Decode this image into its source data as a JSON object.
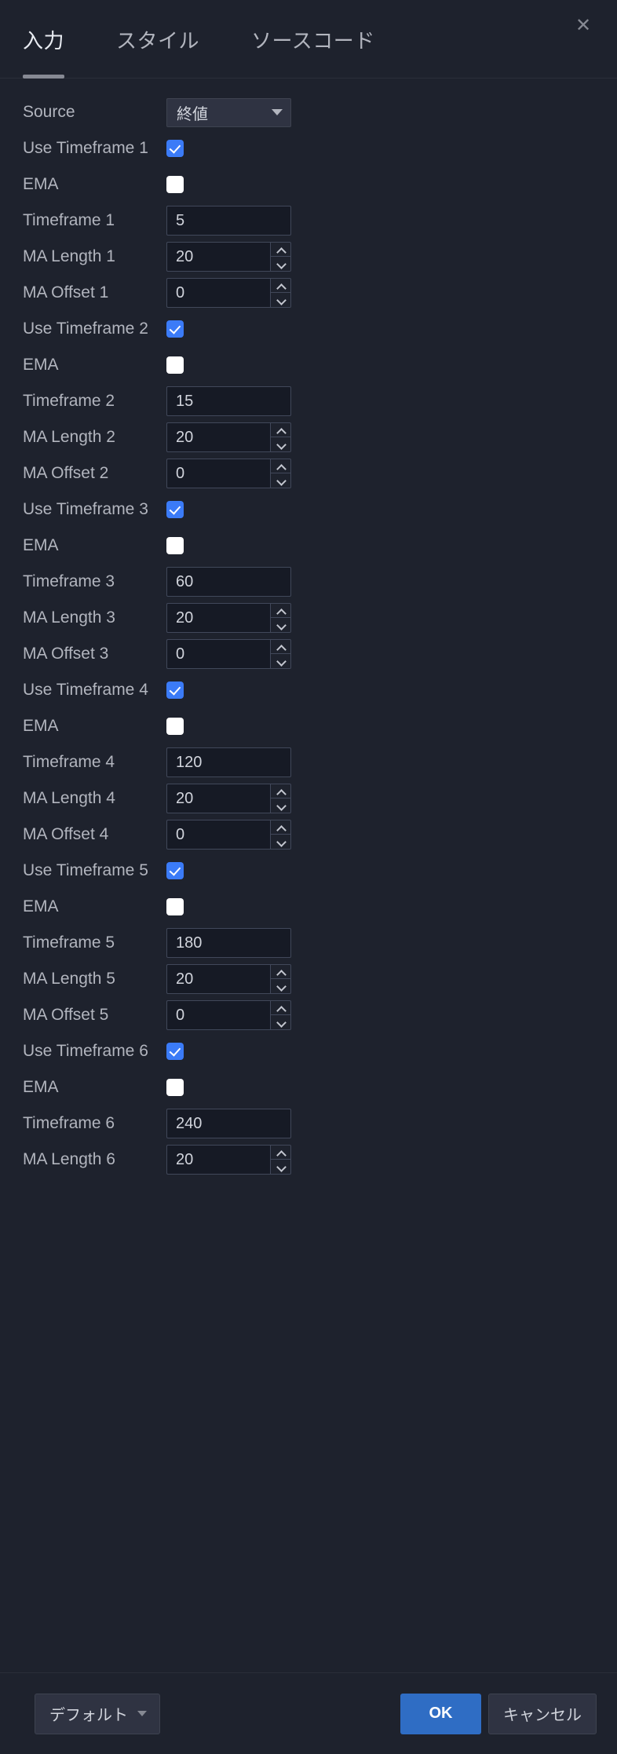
{
  "dialog": {
    "tabs": [
      {
        "label": "入力",
        "active": true
      },
      {
        "label": "スタイル",
        "active": false
      },
      {
        "label": "ソースコード",
        "active": false
      }
    ],
    "close_icon": "close-icon"
  },
  "rows": [
    {
      "label": "Source",
      "type": "select",
      "value": "終値"
    },
    {
      "label": "Use Timeframe 1",
      "type": "checkbox",
      "checked": true
    },
    {
      "label": "EMA",
      "type": "checkbox",
      "checked": false
    },
    {
      "label": "Timeframe 1",
      "type": "text",
      "value": "5"
    },
    {
      "label": "MA Length 1",
      "type": "number",
      "value": "20"
    },
    {
      "label": "MA Offset 1",
      "type": "number",
      "value": "0"
    },
    {
      "label": "Use Timeframe 2",
      "type": "checkbox",
      "checked": true
    },
    {
      "label": "EMA",
      "type": "checkbox",
      "checked": false
    },
    {
      "label": "Timeframe 2",
      "type": "text",
      "value": "15"
    },
    {
      "label": "MA Length 2",
      "type": "number",
      "value": "20"
    },
    {
      "label": "MA Offset 2",
      "type": "number",
      "value": "0"
    },
    {
      "label": "Use Timeframe 3",
      "type": "checkbox",
      "checked": true
    },
    {
      "label": "EMA",
      "type": "checkbox",
      "checked": false
    },
    {
      "label": "Timeframe 3",
      "type": "text",
      "value": "60"
    },
    {
      "label": "MA Length 3",
      "type": "number",
      "value": "20"
    },
    {
      "label": "MA Offset 3",
      "type": "number",
      "value": "0"
    },
    {
      "label": "Use Timeframe 4",
      "type": "checkbox",
      "checked": true
    },
    {
      "label": "EMA",
      "type": "checkbox",
      "checked": false
    },
    {
      "label": "Timeframe 4",
      "type": "text",
      "value": "120"
    },
    {
      "label": "MA Length 4",
      "type": "number",
      "value": "20"
    },
    {
      "label": "MA Offset 4",
      "type": "number",
      "value": "0"
    },
    {
      "label": "Use Timeframe 5",
      "type": "checkbox",
      "checked": true
    },
    {
      "label": "EMA",
      "type": "checkbox",
      "checked": false
    },
    {
      "label": "Timeframe 5",
      "type": "text",
      "value": "180"
    },
    {
      "label": "MA Length 5",
      "type": "number",
      "value": "20"
    },
    {
      "label": "MA Offset 5",
      "type": "number",
      "value": "0"
    },
    {
      "label": "Use Timeframe 6",
      "type": "checkbox",
      "checked": true
    },
    {
      "label": "EMA",
      "type": "checkbox",
      "checked": false
    },
    {
      "label": "Timeframe 6",
      "type": "text",
      "value": "240"
    },
    {
      "label": "MA Length 6",
      "type": "number",
      "value": "20"
    }
  ],
  "footer": {
    "defaults_label": "デフォルト",
    "ok_label": "OK",
    "cancel_label": "キャンセル"
  },
  "colors": {
    "background": "#1e222d",
    "accent_checkbox": "#3b7bf7",
    "accent_ok": "#2f6dc4",
    "input_background": "#161a25",
    "control_background": "#2f3342",
    "text": "#b2b5be"
  }
}
